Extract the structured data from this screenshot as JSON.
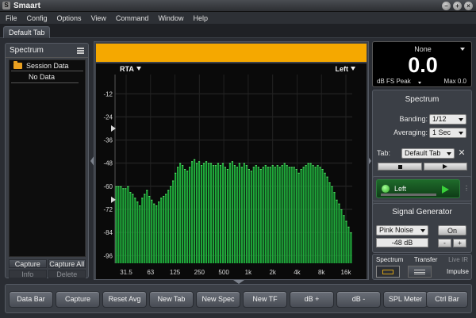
{
  "window": {
    "title": "Smaart",
    "controls": [
      "–",
      "+",
      "×"
    ]
  },
  "menubar": {
    "items": [
      "File",
      "Config",
      "Options",
      "View",
      "Command",
      "Window",
      "Help"
    ]
  },
  "tabs": [
    {
      "label": "Default Tab"
    }
  ],
  "left_panel": {
    "title": "Spectrum",
    "session_label": "Session Data",
    "no_data_label": "No Data",
    "buttons": {
      "capture": "Capture",
      "capture_all": "Capture All",
      "info": "Info",
      "delete": "Delete"
    }
  },
  "graph": {
    "mode_label": "RTA",
    "channel_label": "Left",
    "header_color": "#f5a800",
    "bar_color": "#1fa83a",
    "y_ticks": [
      "-12",
      "-24",
      "-36",
      "-48",
      "-60",
      "-72",
      "-84",
      "-96"
    ],
    "x_ticks": [
      "31.5",
      "63",
      "125",
      "250",
      "500",
      "1k",
      "2k",
      "4k",
      "8k",
      "16k"
    ]
  },
  "chart_data": {
    "type": "bar",
    "title": "",
    "xlabel": "",
    "ylabel": "",
    "ylim": [
      -100,
      -2
    ],
    "grid": true,
    "bands_per_octave": 12,
    "x_range": [
      "31.5",
      "16k"
    ],
    "series": [
      {
        "values": [
          -60,
          -60,
          -60,
          -61,
          -61,
          -60,
          -63,
          -64,
          -66,
          -68,
          -70,
          -66,
          -64,
          -62,
          -65,
          -67,
          -69,
          -70,
          -68,
          -66,
          -65,
          -64,
          -62,
          -60,
          -57,
          -53,
          -50,
          -48,
          -49,
          -51,
          -52,
          -50,
          -47,
          -46,
          -48,
          -47,
          -49,
          -48,
          -47,
          -48,
          -48,
          -49,
          -49,
          -48,
          -49,
          -48,
          -50,
          -51,
          -48,
          -47,
          -49,
          -50,
          -48,
          -50,
          -48,
          -49,
          -51,
          -52,
          -50,
          -49,
          -50,
          -51,
          -50,
          -49,
          -50,
          -50,
          -49,
          -50,
          -49,
          -50,
          -49,
          -48,
          -49,
          -50,
          -50,
          -50,
          -51,
          -53,
          -51,
          -50,
          -49,
          -48,
          -48,
          -49,
          -50,
          -49,
          -50,
          -51,
          -53,
          -55,
          -58,
          -60,
          -63,
          -67,
          -69,
          -72,
          -75,
          -78,
          -81,
          -84
        ]
      }
    ]
  },
  "meter": {
    "source": "None",
    "value": "0.0",
    "mode": "dB FS Peak",
    "max_label": "Max 0.0"
  },
  "spectrum_settings": {
    "title": "Spectrum",
    "banding_label": "Banding:",
    "banding_value": "1/12",
    "averaging_label": "Averaging:",
    "averaging_value": "1 Sec",
    "tab_label": "Tab:",
    "tab_value": "Default Tab"
  },
  "channel": {
    "name": "Left",
    "active_color": "#39d039"
  },
  "signal_generator": {
    "title": "Signal Generator",
    "type": "Pink Noise",
    "on_label": "On",
    "level": "-48 dB",
    "minus": "-",
    "plus": "+"
  },
  "modes": {
    "spectrum": "Spectrum",
    "transfer": "Transfer",
    "live_ir": "Live IR",
    "impulse": "Impulse"
  },
  "command_bar": {
    "buttons": [
      "Data Bar",
      "Capture",
      "Reset Avg",
      "New Tab",
      "New Spec",
      "New TF",
      "dB +",
      "dB -",
      "SPL Meter",
      "Ctrl Bar"
    ]
  }
}
